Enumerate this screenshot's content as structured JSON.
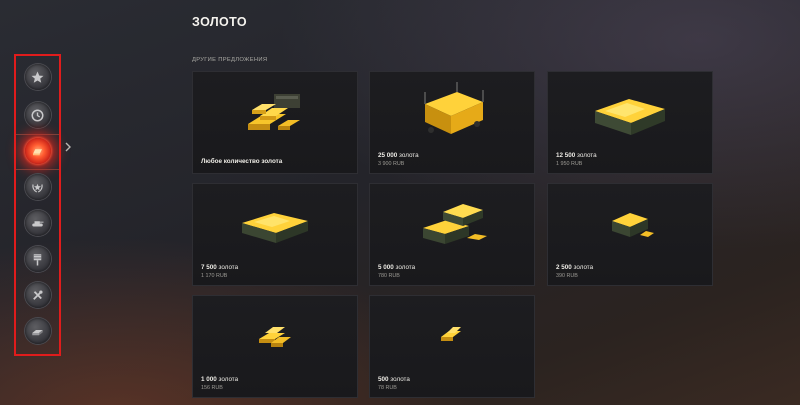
{
  "page": {
    "title": "ЗОЛОТО",
    "section_label": "ДРУГИЕ ПРЕДЛОЖЕНИЯ"
  },
  "sidebar": {
    "items": [
      {
        "icon": "star-icon"
      },
      {
        "icon": "clock-icon"
      },
      {
        "icon": "gold-bar-icon",
        "active": true
      },
      {
        "icon": "wreath-star-icon"
      },
      {
        "icon": "tank-icon"
      },
      {
        "icon": "flag-icon"
      },
      {
        "icon": "wrench-icon"
      },
      {
        "icon": "stack-icon"
      }
    ]
  },
  "offers": [
    {
      "label": "Любое количество золота",
      "art": "bars-with-equipment"
    },
    {
      "amount": "25 000",
      "unit": "золота",
      "price": "3 900 RUB",
      "art": "cart"
    },
    {
      "amount": "12 500",
      "unit": "золота",
      "price": "1 950 RUB",
      "art": "large-crate"
    },
    {
      "amount": "7 500",
      "unit": "золота",
      "price": "1 170 RUB",
      "art": "crate"
    },
    {
      "amount": "5 000",
      "unit": "золота",
      "price": "780 RUB",
      "art": "boxes"
    },
    {
      "amount": "2 500",
      "unit": "золота",
      "price": "390 RUB",
      "art": "small-box"
    },
    {
      "amount": "1 000",
      "unit": "золота",
      "price": "156 RUB",
      "art": "few-bars"
    },
    {
      "amount": "500",
      "unit": "золота",
      "price": "78 RUB",
      "art": "two-bars"
    }
  ],
  "colors": {
    "highlight_frame": "#e01c1c",
    "gold": "#f2b91c",
    "active_glow": "#ff4a2a"
  }
}
